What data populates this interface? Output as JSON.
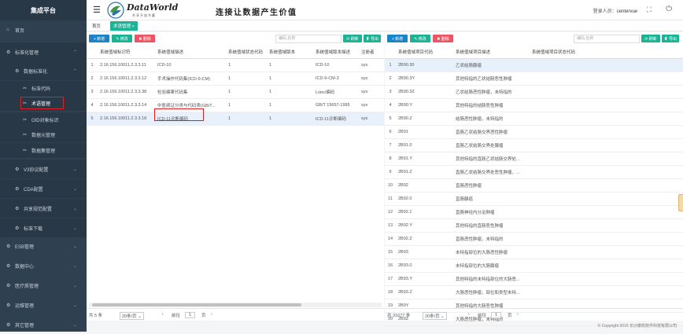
{
  "sidebar": {
    "title": "集成平台",
    "items": [
      {
        "label": "首页",
        "icon": "home-icon",
        "glyph": "⌂"
      },
      {
        "label": "标准化管理",
        "icon": "gear-icon",
        "glyph": "⚙",
        "chev": "⌃"
      },
      {
        "label": "数据标准化",
        "icon": "gear-icon",
        "glyph": "⚙",
        "chev": "⌃"
      },
      {
        "label": "标准代码",
        "icon": "tools-icon",
        "glyph": "✂"
      },
      {
        "label": "术语管理",
        "icon": "tools-icon",
        "glyph": "✂"
      },
      {
        "label": "OID对象标识",
        "icon": "tools-icon",
        "glyph": "✂"
      },
      {
        "label": "数据元管理",
        "icon": "tools-icon",
        "glyph": "✂"
      },
      {
        "label": "数据集管理",
        "icon": "tools-icon",
        "glyph": "✂"
      },
      {
        "label": "V3协议配置",
        "icon": "gear-icon",
        "glyph": "⚙",
        "chev": "⌄"
      },
      {
        "label": "CDA配置",
        "icon": "gear-icon",
        "glyph": "⚙",
        "chev": "⌄"
      },
      {
        "label": "共享规范配置",
        "icon": "gear-icon",
        "glyph": "⚙",
        "chev": "⌄"
      },
      {
        "label": "标准下载",
        "icon": "gear-icon",
        "glyph": "⚙",
        "chev": "⌄"
      },
      {
        "label": "ESB管理",
        "icon": "gear-icon",
        "glyph": "⚙",
        "chev": "⌄"
      },
      {
        "label": "数据中心",
        "icon": "gear-icon",
        "glyph": "⚙",
        "chev": "⌄"
      },
      {
        "label": "医疗质管理",
        "icon": "gear-icon",
        "glyph": "⚙",
        "chev": "⌄"
      },
      {
        "label": "运维管理",
        "icon": "gear-icon",
        "glyph": "⚙",
        "chev": "⌄"
      },
      {
        "label": "其它管理",
        "icon": "gear-icon",
        "glyph": "⚙",
        "chev": "⌄"
      }
    ]
  },
  "header": {
    "menu_icon": "☰",
    "logo_text": "DataWorld",
    "logo_sub": "共享开放共赢",
    "slogan": "连接让数据产生价值",
    "login_label": "登录人员：",
    "user": "centervue",
    "expand_icon": "⛶",
    "close_icon": "⏻"
  },
  "tabs": {
    "home": "首页",
    "term": "术语管理 ×"
  },
  "left": {
    "add": "+ 新增",
    "edit": "✎ 修改",
    "del": "✖ 删除",
    "search_placeholder": "编码,名称",
    "refresh": "⟳ 刷新",
    "export": "⬆ 导出",
    "columns": [
      "",
      "系统值域标识符",
      "系统值域描述",
      "系统值域状态代码",
      "系统值域版本",
      "系统值域版本描述",
      "注册者"
    ],
    "rows": [
      [
        "1",
        "2.16.156.10011.2.3.3.11",
        "ICD-10",
        "1",
        "1",
        "ICD-10",
        "sys"
      ],
      [
        "2",
        "2.16.156.10011.2.3.3.12",
        "手术操作代码集(ICD-9-CM)",
        "1",
        "1",
        "ICD-9-CM-3",
        "sys"
      ],
      [
        "3",
        "2.16.156.10011.2.3.3.38",
        "检验编果代码集",
        "1",
        "1",
        "Loinc编码",
        "sys"
      ],
      [
        "4",
        "2.16.156.10011.2.3.3.14",
        "中医病证分类与代码表(GB/T...",
        "1",
        "1",
        "GB/T 15657-1995",
        "sys"
      ],
      [
        "5",
        "2.16.156.10011.2.3.3.18",
        "ICD-11诊断编码",
        "1",
        "1",
        "ICD-11诊断编码",
        "sys"
      ]
    ],
    "total": "共 5 条",
    "per_page": "20条/页 ⌄",
    "prev": "‹",
    "goto": "前往",
    "page": "1",
    "page_unit": "页",
    "next": "›"
  },
  "right": {
    "add": "+ 新增",
    "edit": "✎ 修改",
    "del": "✖ 删除",
    "search_placeholder": "编码,名称",
    "refresh": "⟳ 刷新",
    "export": "⬆ 导出",
    "columns": [
      "",
      "系统值域项目代码",
      "系统值域项目描述",
      "系统值域项目状态代码"
    ],
    "rows": [
      [
        "1",
        "2B90.30",
        "乙状结肠腺瘤",
        ""
      ],
      [
        "2",
        "2B90.3Y",
        "其他特指的乙状结肠恶性肿瘤",
        ""
      ],
      [
        "3",
        "2B90.3Z",
        "乙状结肠恶性肿瘤，未特指的",
        ""
      ],
      [
        "4",
        "2B90.Y",
        "其他特指的结肠恶性肿瘤",
        ""
      ],
      [
        "5",
        "2B90.Z",
        "结肠恶性肿瘤，未特指的",
        ""
      ],
      [
        "6",
        "2B91",
        "直肠乙状结肠交界恶性肿瘤",
        ""
      ],
      [
        "7",
        "2B91.0",
        "直肠乙状结肠交界处腺瘤",
        ""
      ],
      [
        "8",
        "2B91.Y",
        "其他特指的直肠乙状结肠交界处...",
        ""
      ],
      [
        "9",
        "2B91.Z",
        "直肠乙状结肠交界处恶性肿瘤，...",
        ""
      ],
      [
        "10",
        "2B92",
        "直肠恶性肿瘤",
        ""
      ],
      [
        "11",
        "2B92.0",
        "直肠腺癌",
        ""
      ],
      [
        "12",
        "2B92.1",
        "直肠神经内分泌肿瘤",
        ""
      ],
      [
        "13",
        "2B92.Y",
        "其他特指的直肠恶性肿瘤",
        ""
      ],
      [
        "14",
        "2B92.Z",
        "直肠恶性肿瘤，未特指的",
        ""
      ],
      [
        "15",
        "2B93",
        "未特指部位的大肠恶性肿瘤",
        ""
      ],
      [
        "16",
        "2B93.0",
        "未特指部位的大肠腺瘤",
        ""
      ],
      [
        "17",
        "2B93.Y",
        "其他特指的未特指部位的大肠恶...",
        ""
      ],
      [
        "18",
        "2B93.Z",
        "大肠恶性肿瘤，部位和类型未特...",
        ""
      ],
      [
        "19",
        "2B9Y",
        "其他特指的大肠恶性肿瘤",
        ""
      ],
      [
        "20",
        "2B9Z",
        "大肠恶性肿瘤，未特指的",
        ""
      ]
    ],
    "total": "共 31677 条",
    "per_page": "20条/页 ⌄",
    "prev": "‹",
    "goto": "前往",
    "page": "1",
    "page_unit": "页",
    "next": "›"
  },
  "copyright": "© Copyright 2016 长沙康凯软件科技有限公司"
}
